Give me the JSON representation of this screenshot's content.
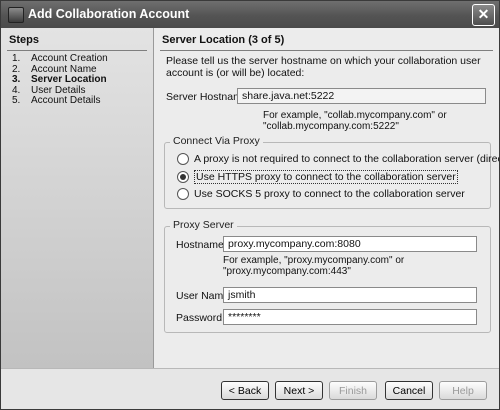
{
  "window": {
    "title": "Add Collaboration Account",
    "close_glyph": "✕"
  },
  "steps": {
    "heading": "Steps",
    "items": [
      {
        "num": "1.",
        "label": "Account Creation"
      },
      {
        "num": "2.",
        "label": "Account Name"
      },
      {
        "num": "3.",
        "label": "Server Location",
        "current": true
      },
      {
        "num": "4.",
        "label": "User Details"
      },
      {
        "num": "5.",
        "label": "Account Details"
      }
    ]
  },
  "content": {
    "heading": "Server Location (3 of 5)",
    "intro": "Please tell us the server hostname on which your collaboration user account is (or will be) located:",
    "server_hostname": {
      "label": "Server Hostname:",
      "value": "share.java.net:5222",
      "example_line1": "For example, \"collab.mycompany.com\" or",
      "example_line2": "\"collab.mycompany.com:5222\""
    },
    "proxy_group": {
      "legend": "Connect Via Proxy",
      "options": [
        {
          "label": "A proxy is not required to connect to the collaboration server (direct conn...",
          "checked": false
        },
        {
          "label": "Use HTTPS proxy to connect to the collaboration server",
          "checked": true
        },
        {
          "label": "Use SOCKS 5 proxy to connect to the collaboration server",
          "checked": false
        }
      ]
    },
    "proxy_server": {
      "legend": "Proxy Server",
      "hostname_label": "Hostname:",
      "hostname_value": "proxy.mycompany.com:8080",
      "example_line1": "For example, \"proxy.mycompany.com\" or",
      "example_line2": "\"proxy.mycompany.com:443\"",
      "username_label": "User Name:",
      "username_value": "jsmith",
      "password_label": "Password:",
      "password_value": "********"
    }
  },
  "buttons": {
    "back": "< Back",
    "next": "Next >",
    "finish": "Finish",
    "cancel": "Cancel",
    "help": "Help"
  }
}
